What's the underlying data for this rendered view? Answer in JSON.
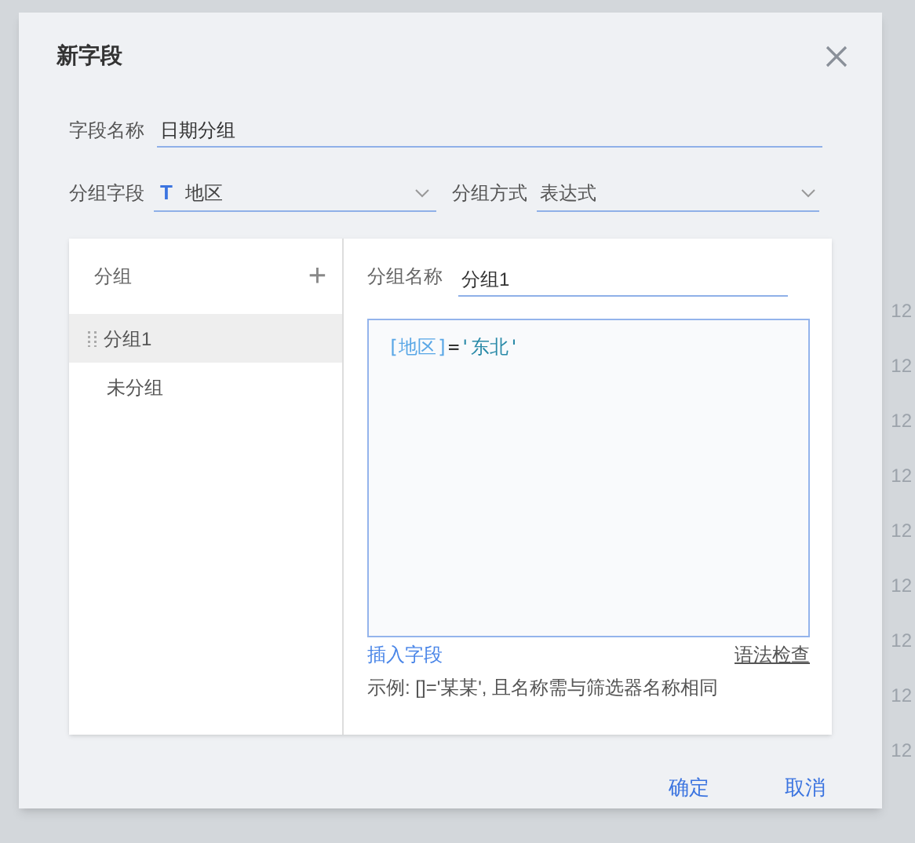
{
  "backdrop_cells": [
    "12",
    "12",
    "12",
    "12",
    "12",
    "12",
    "12",
    "12",
    "12"
  ],
  "dialog": {
    "title": "新字段",
    "field_name": {
      "label": "字段名称",
      "value": "日期分组"
    },
    "group_field": {
      "label": "分组字段",
      "icon_text": "T",
      "value": "地区"
    },
    "group_method": {
      "label": "分组方式",
      "value": "表达式"
    },
    "groups": {
      "header": "分组",
      "add": "+",
      "items": [
        {
          "label": "分组1",
          "selected": true,
          "draggable": true
        },
        {
          "label": "未分组",
          "selected": false,
          "draggable": false
        }
      ]
    },
    "editor": {
      "name_label": "分组名称",
      "name_value": "分组1",
      "expression": [
        {
          "kind": "field",
          "text": "[地区]"
        },
        {
          "kind": "operator",
          "text": "="
        },
        {
          "kind": "string",
          "text": "'东北'"
        }
      ],
      "insert_link": "插入字段",
      "check_link": "语法检查",
      "example": "示例: []='某某', 且名称需与筛选器名称相同"
    },
    "buttons": [
      "确定",
      "取消"
    ]
  }
}
